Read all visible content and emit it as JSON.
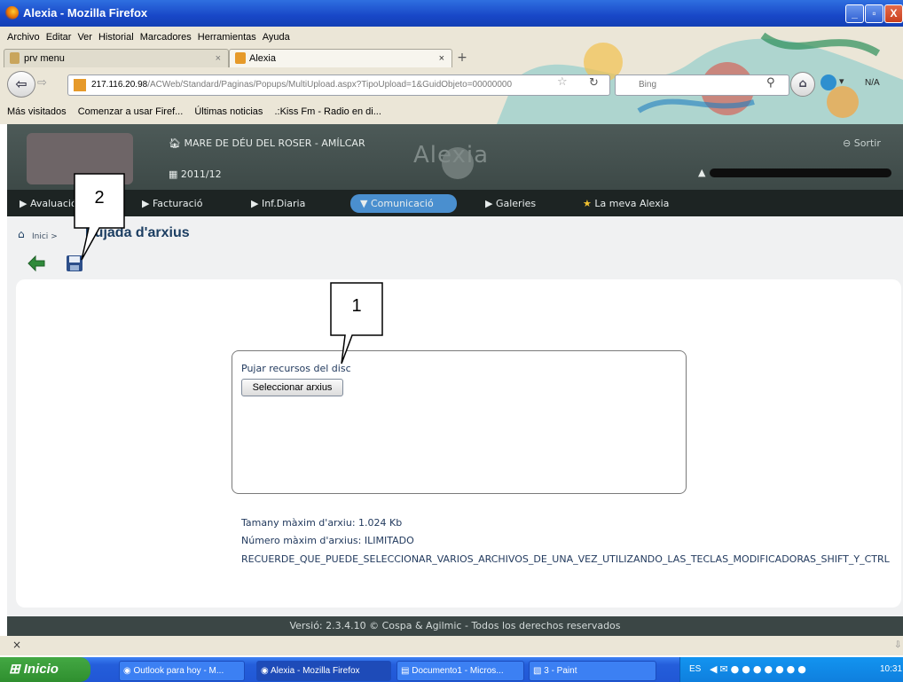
{
  "window": {
    "title": "Alexia - Mozilla Firefox",
    "buttons": [
      "_",
      "▫",
      "X"
    ]
  },
  "menubar": [
    "Archivo",
    "Editar",
    "Ver",
    "Historial",
    "Marcadores",
    "Herramientas",
    "Ayuda"
  ],
  "tabs": [
    {
      "label": "prv menu"
    },
    {
      "label": "Alexia"
    }
  ],
  "address": {
    "host": "217.116.20.98",
    "path": "/ACWeb/Standard/Paginas/Popups/MultiUpload.aspx?TipoUpload=1&GuidObjeto=00000000",
    "search_placeholder": "Bing",
    "na": "N/A"
  },
  "bookmarks": [
    "Más visitados",
    "Comenzar a usar Firef...",
    "Últimas noticias",
    ".:Kiss Fm - Radio en di..."
  ],
  "app": {
    "school": "MARE DE DÉU DEL ROSER - AMÍLCAR",
    "year": "2011/12",
    "brand": "Alexia",
    "logout": "Sortir",
    "nav": [
      "Avaluació",
      "Facturació",
      "Inf.Diaria",
      "Comunicació",
      "Galeries",
      "La meva Alexia"
    ],
    "breadcrumb_home": "Inici",
    "breadcrumb_sep": ">",
    "page_title": "Pujada d'arxius"
  },
  "upload": {
    "label": "Pujar recursos del disc",
    "button": "Seleccionar arxius",
    "max_size": "Tamany màxim d'arxiu: 1.024 Kb",
    "max_files": "Número màxim d'arxius: ILIMITADO",
    "hint": "RECUERDE_QUE_PUEDE_SELECCIONAR_VARIOS_ARCHIVOS_DE_UNA_VEZ_UTILIZANDO_LAS_TECLAS_MODIFICADORAS_SHIFT_Y_CTRL"
  },
  "footer": "Versió: 2.3.4.10 © Cospa & Agilmic - Todos los derechos reservados",
  "findbar_close": "×",
  "callouts": {
    "one": "1",
    "two": "2"
  },
  "taskbar": {
    "start": "Inicio",
    "tasks": [
      "Outlook para hoy - M...",
      "Alexia - Mozilla Firefox",
      "Documento1 - Micros...",
      "3 - Paint"
    ],
    "lang": "ES",
    "clock": "10:31"
  },
  "colors": {
    "app_header": "#46524f",
    "nav_active": "#4a8fcf",
    "title_text": "#1c3e62"
  }
}
